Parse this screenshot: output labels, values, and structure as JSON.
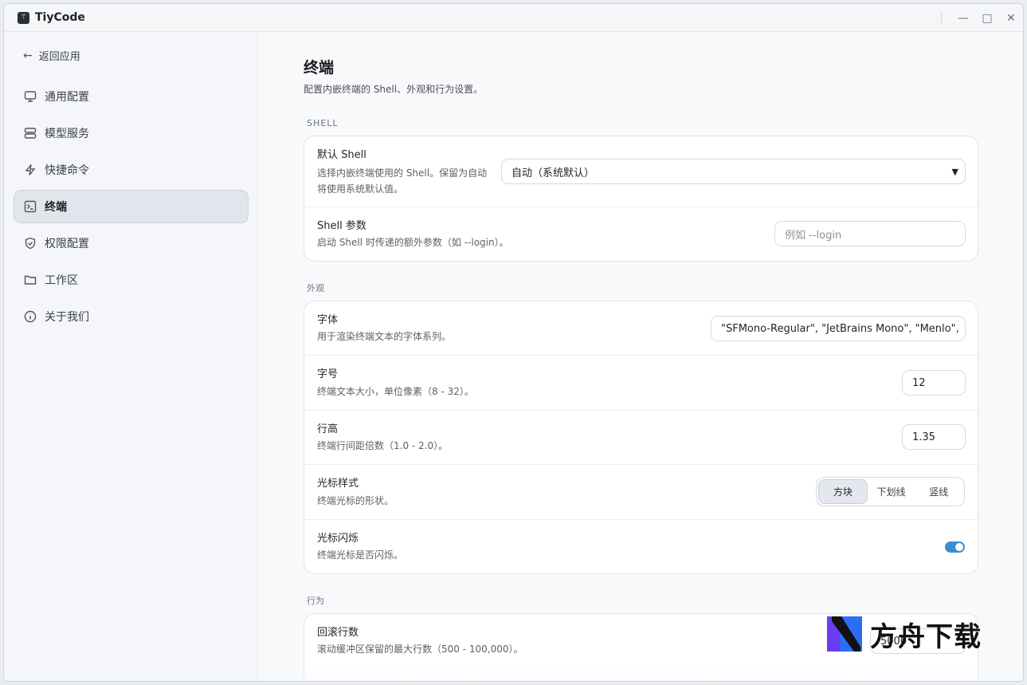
{
  "app": {
    "title": "TiyCode"
  },
  "sidebar": {
    "back_label": "返回应用",
    "items": [
      {
        "label": "通用配置",
        "icon": "monitor-icon"
      },
      {
        "label": "模型服务",
        "icon": "server-icon"
      },
      {
        "label": "快捷命令",
        "icon": "lightning-icon"
      },
      {
        "label": "终端",
        "icon": "terminal-icon",
        "active": true
      },
      {
        "label": "权限配置",
        "icon": "shield-icon"
      },
      {
        "label": "工作区",
        "icon": "folder-icon"
      },
      {
        "label": "关于我们",
        "icon": "info-icon"
      }
    ]
  },
  "main": {
    "title": "终端",
    "subtitle": "配置内嵌终端的 Shell、外观和行为设置。",
    "sections": {
      "shell": {
        "label": "SHELL",
        "default_shell": {
          "title": "默认 Shell",
          "desc_line1": "选择内嵌终端使用的 Shell。保留为自动",
          "desc_line2": "将使用系统默认值。",
          "value": "自动（系统默认）"
        },
        "shell_args": {
          "title": "Shell 参数",
          "desc": "启动 Shell 时传递的额外参数（如 --login）。",
          "placeholder": "例如 --login"
        }
      },
      "appearance": {
        "label": "外观",
        "font": {
          "title": "字体",
          "desc": "用于渲染终端文本的字体系列。",
          "value": "\"SFMono-Regular\", \"JetBrains Mono\", \"Menlo\","
        },
        "font_size": {
          "title": "字号",
          "desc": "终端文本大小，单位像素（8 - 32）。",
          "value": "12"
        },
        "line_height": {
          "title": "行高",
          "desc": "终端行间距倍数（1.0 - 2.0）。",
          "value": "1.35"
        },
        "cursor_style": {
          "title": "光标样式",
          "desc": "终端光标的形状。",
          "options": [
            "方块",
            "下划线",
            "竖线"
          ],
          "selected": "方块"
        },
        "cursor_blink": {
          "title": "光标闪烁",
          "desc": "终端光标是否闪烁。",
          "enabled": true
        }
      },
      "behavior": {
        "label": "行为",
        "scrollback": {
          "title": "回滚行数",
          "desc": "滚动缓冲区保留的最大行数（500 - 100,000）。",
          "value": "5000"
        }
      }
    }
  },
  "watermark": {
    "text": "方舟下载"
  },
  "colors": {
    "accent": "#3b8ed4",
    "active_nav": "#e2e6ec"
  }
}
